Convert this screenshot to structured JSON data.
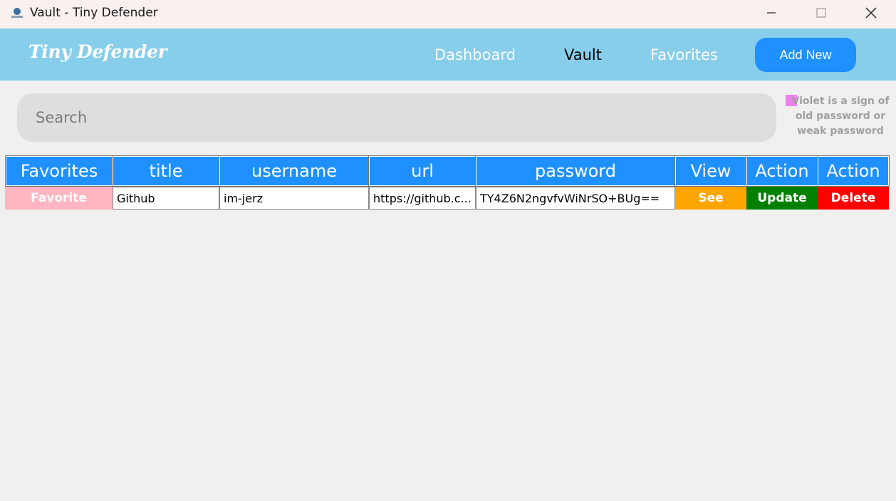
{
  "window": {
    "title": "Vault - Tiny Defender",
    "icon": "app-logo-icon",
    "controls": [
      "minimize-icon",
      "maximize-icon",
      "close-icon"
    ]
  },
  "navbar": {
    "brand": "Tiny Defender",
    "links": [
      "Dashboard",
      "Vault",
      "Favorites"
    ],
    "active": "Vault",
    "add_new_label": "Add New",
    "background": "#87ceeb",
    "accent": "#1e90ff"
  },
  "search": {
    "placeholder": "Search",
    "value": ""
  },
  "legend": {
    "text": "Violet is a sign of old password or weak password",
    "color": "#ee82ee"
  },
  "table": {
    "headers": [
      "Favorites",
      "title",
      "username",
      "url",
      "password",
      "View",
      "Action",
      "Action"
    ],
    "rows": [
      {
        "favorite_label": "Favorite",
        "title": "Github",
        "username": "im-jerz",
        "url": "https://github.c...",
        "password": "TY4Z6N2ngvfvWiNrSO+BUg==",
        "view_label": "See",
        "update_label": "Update",
        "delete_label": "Delete"
      }
    ],
    "colors": {
      "favorite": "#ffb6c1",
      "see": "#ffa500",
      "update": "#008000",
      "delete": "#ff0000"
    }
  }
}
